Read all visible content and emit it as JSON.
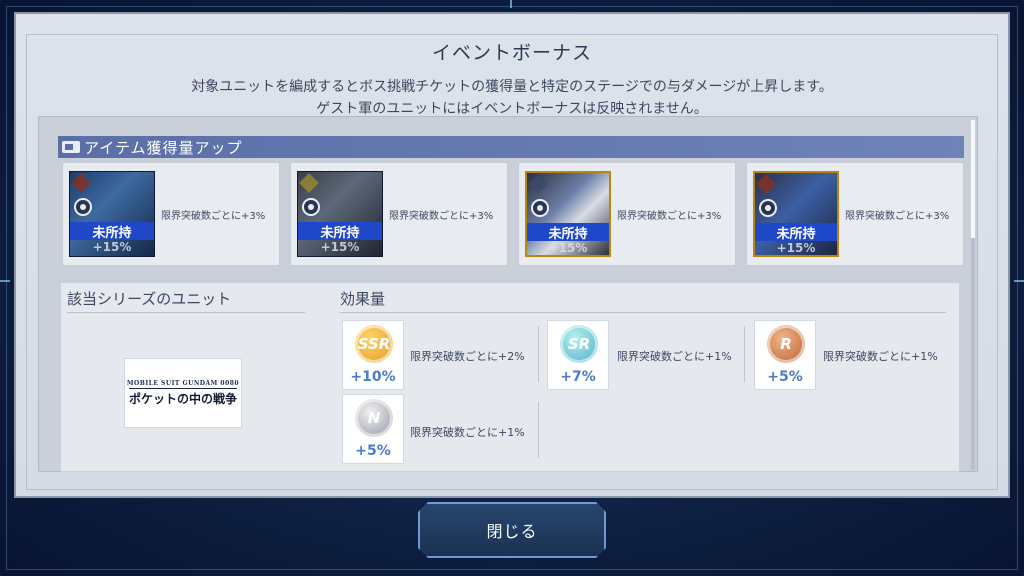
{
  "dialog": {
    "title": "イベントボーナス",
    "description_line1": "対象ユニットを編成するとボス挑戦チケットの獲得量と特定のステージでの与ダメージが上昇します。",
    "description_line2": "ゲスト軍のユニットにはイベントボーナスは反映されません。"
  },
  "item_section": {
    "header": "アイテム獲得量アップ",
    "units": [
      {
        "status": "未所持",
        "bonus": "+15%",
        "effect": "限界突破数ごとに+3%"
      },
      {
        "status": "未所持",
        "bonus": "+15%",
        "effect": "限界突破数ごとに+3%"
      },
      {
        "status": "未所持",
        "bonus": "+15%",
        "effect": "限界突破数ごとに+3%"
      },
      {
        "status": "未所持",
        "bonus": "+15%",
        "effect": "限界突破数ごとに+3%"
      }
    ]
  },
  "series_section": {
    "title": "該当シリーズのユニット",
    "logo_line1": "MOBILE SUIT GUNDAM 0080",
    "logo_line2": "ポケットの中の戦争"
  },
  "effect_section": {
    "title": "効果量",
    "rarities": [
      {
        "rank": "SSR",
        "value": "+10%",
        "text": "限界突破数ごとに+2%"
      },
      {
        "rank": "SR",
        "value": "+7%",
        "text": "限界突破数ごとに+1%"
      },
      {
        "rank": "R",
        "value": "+5%",
        "text": "限界突破数ごとに+1%"
      },
      {
        "rank": "N",
        "value": "+5%",
        "text": "限界突破数ごとに+1%"
      }
    ]
  },
  "close_button": "閉じる"
}
